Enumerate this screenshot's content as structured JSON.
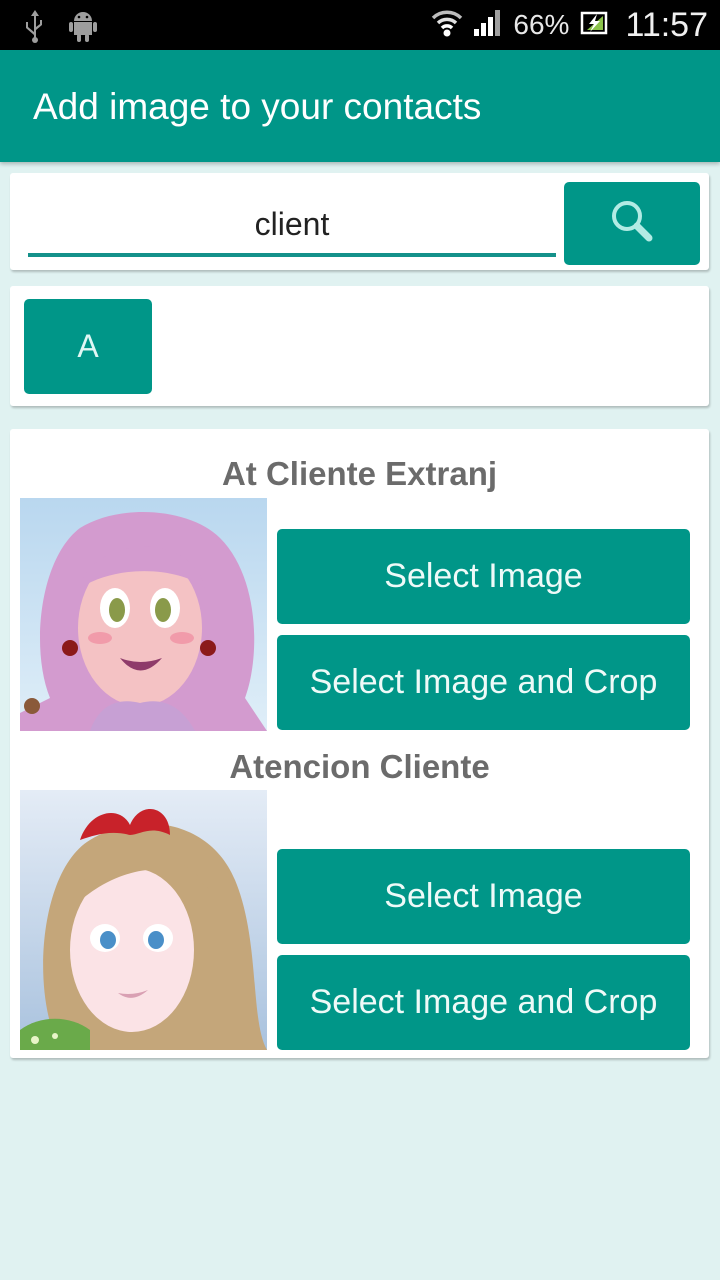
{
  "status_bar": {
    "left_icons": [
      "usb-icon",
      "android-debug-icon"
    ],
    "right_icons": [
      "wifi-icon",
      "signal-icon",
      "battery-charging-icon"
    ],
    "battery_percent": "66%",
    "time": "11:57"
  },
  "app_bar": {
    "title": "Add image to your contacts"
  },
  "search": {
    "value": "client",
    "button_icon": "search-icon"
  },
  "letter_index": {
    "letters": [
      "A"
    ]
  },
  "contacts": [
    {
      "name": "At Cliente Extranj",
      "avatar": "anime-girl-pink-hair",
      "select_image_label": "Select Image",
      "select_crop_label": "Select Image and Crop"
    },
    {
      "name": "Atencion Cliente",
      "avatar": "anime-elf-girl-blonde-hair",
      "select_image_label": "Select Image",
      "select_crop_label": "Select Image and Crop"
    }
  ],
  "colors": {
    "primary": "#009688",
    "background": "#e0f2f1",
    "name_text": "#6b6b6b"
  }
}
